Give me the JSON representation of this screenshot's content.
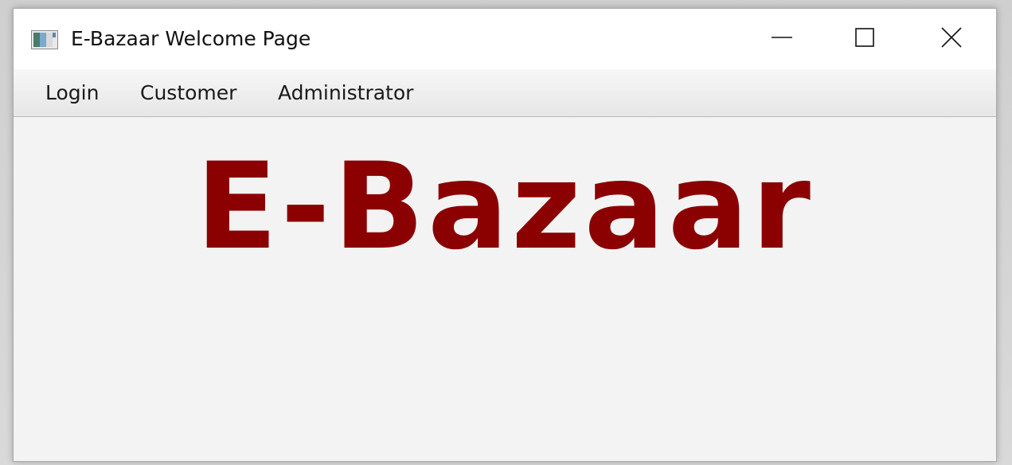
{
  "window": {
    "title": "E-Bazaar Welcome Page",
    "icon": "java-app-icon"
  },
  "title_buttons": {
    "minimize": "minimize-icon",
    "maximize": "maximize-icon",
    "close": "close-icon"
  },
  "menubar": {
    "items": [
      {
        "label": "Login"
      },
      {
        "label": "Customer"
      },
      {
        "label": "Administrator"
      }
    ]
  },
  "content": {
    "banner_text": "E-Bazaar",
    "banner_color": "#8b0000"
  }
}
